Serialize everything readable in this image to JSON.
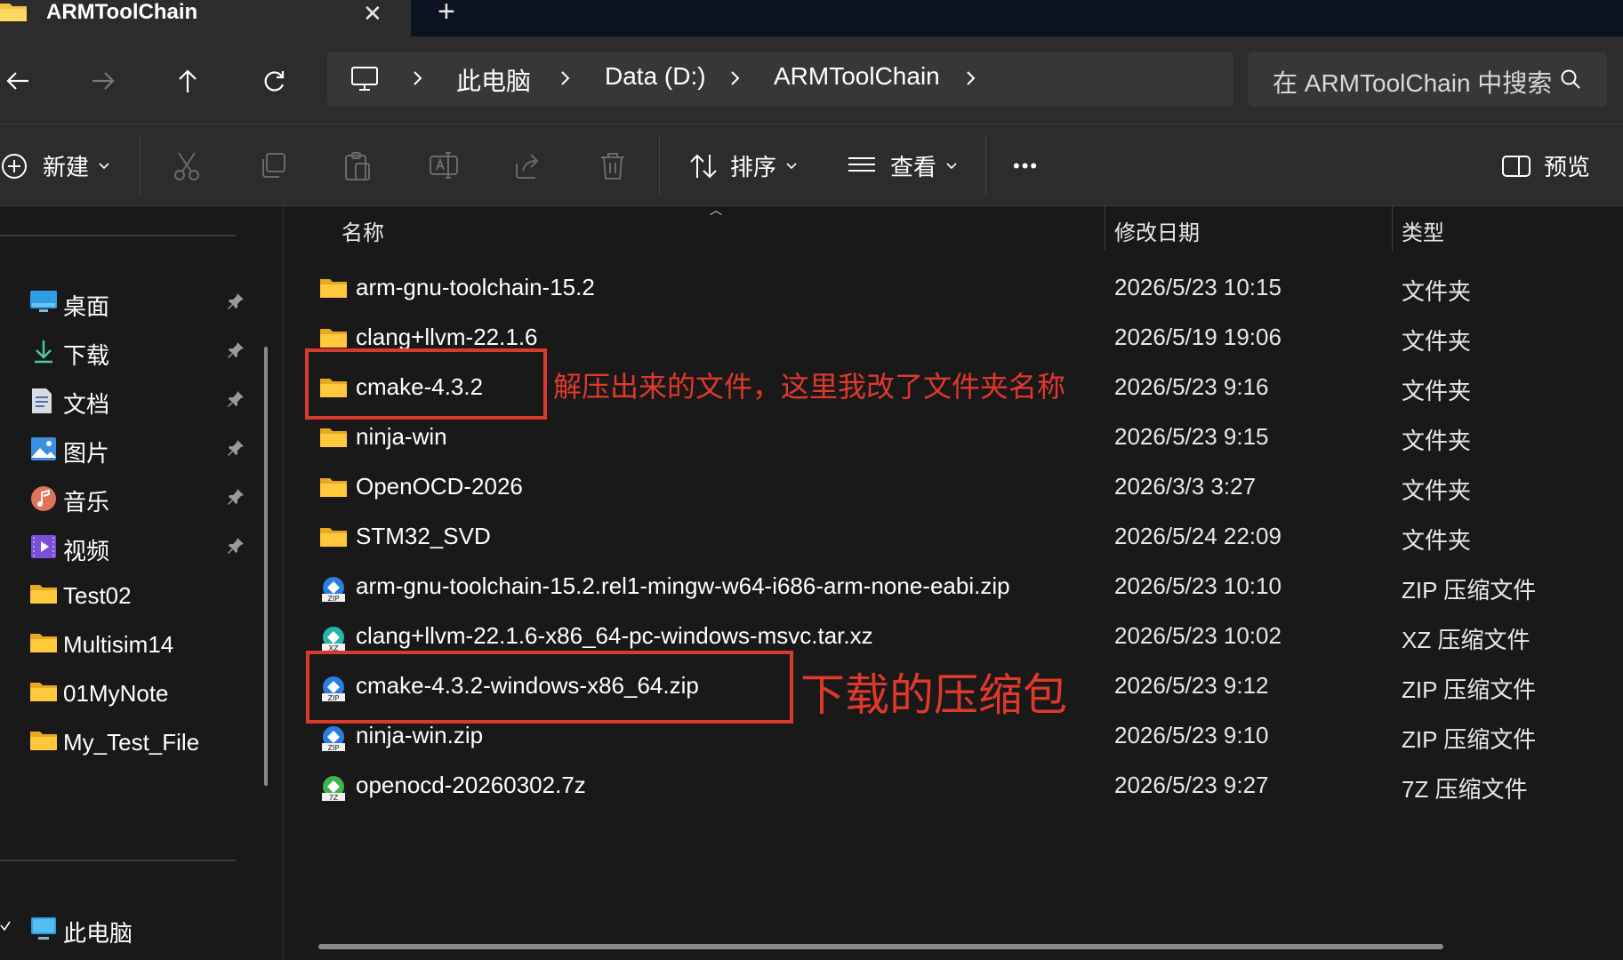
{
  "window": {
    "tab_title": "ARMToolChain",
    "close_glyph": "✕",
    "newtab_glyph": "+"
  },
  "nav": {
    "breadcrumbs": [
      "此电脑",
      "Data (D:)",
      "ARMToolChain"
    ],
    "search_placeholder": "在 ARMToolChain 中搜索"
  },
  "toolbar": {
    "new_label": "新建",
    "sort_label": "排序",
    "view_label": "查看",
    "more_label": "•••",
    "preview_label": "预览"
  },
  "sidebar": {
    "quick_access": [
      {
        "label": "桌面",
        "icon": "desktop-icon",
        "pinned": true
      },
      {
        "label": "下载",
        "icon": "download-icon",
        "pinned": true
      },
      {
        "label": "文档",
        "icon": "document-icon",
        "pinned": true
      },
      {
        "label": "图片",
        "icon": "pictures-icon",
        "pinned": true
      },
      {
        "label": "音乐",
        "icon": "music-icon",
        "pinned": true
      },
      {
        "label": "视频",
        "icon": "videos-icon",
        "pinned": true
      },
      {
        "label": "Test02",
        "icon": "folder-icon",
        "pinned": false
      },
      {
        "label": "Multisim14",
        "icon": "folder-icon",
        "pinned": false
      },
      {
        "label": "01MyNote",
        "icon": "folder-icon",
        "pinned": false
      },
      {
        "label": "My_Test_File",
        "icon": "folder-icon",
        "pinned": false
      }
    ],
    "this_pc_label": "此电脑"
  },
  "columns": {
    "name": "名称",
    "date": "修改日期",
    "type": "类型"
  },
  "files": [
    {
      "name": "arm-gnu-toolchain-15.2",
      "date": "2026/5/23 10:15",
      "type": "文件夹",
      "icon": "folder-icon"
    },
    {
      "name": "clang+llvm-22.1.6",
      "date": "2026/5/19 19:06",
      "type": "文件夹",
      "icon": "folder-icon"
    },
    {
      "name": "cmake-4.3.2",
      "date": "2026/5/23 9:16",
      "type": "文件夹",
      "icon": "folder-icon"
    },
    {
      "name": "ninja-win",
      "date": "2026/5/23 9:15",
      "type": "文件夹",
      "icon": "folder-icon"
    },
    {
      "name": "OpenOCD-2026",
      "date": "2026/3/3 3:27",
      "type": "文件夹",
      "icon": "folder-icon"
    },
    {
      "name": "STM32_SVD",
      "date": "2026/5/24 22:09",
      "type": "文件夹",
      "icon": "folder-icon"
    },
    {
      "name": "arm-gnu-toolchain-15.2.rel1-mingw-w64-i686-arm-none-eabi.zip",
      "date": "2026/5/23 10:10",
      "type": "ZIP 压缩文件",
      "icon": "zip-archive-icon"
    },
    {
      "name": "clang+llvm-22.1.6-x86_64-pc-windows-msvc.tar.xz",
      "date": "2026/5/23 10:02",
      "type": "XZ 压缩文件",
      "icon": "xz-archive-icon"
    },
    {
      "name": "cmake-4.3.2-windows-x86_64.zip",
      "date": "2026/5/23 9:12",
      "type": "ZIP 压缩文件",
      "icon": "zip-archive-icon"
    },
    {
      "name": "ninja-win.zip",
      "date": "2026/5/23 9:10",
      "type": "ZIP 压缩文件",
      "icon": "zip-archive-icon"
    },
    {
      "name": "openocd-20260302.7z",
      "date": "2026/5/23 9:27",
      "type": "7Z 压缩文件",
      "icon": "7z-archive-icon"
    }
  ],
  "annotations": {
    "extracted_note": "解压出来的文件，这里我改了文件夹名称",
    "download_note": "下载的压缩包",
    "color": "#e0392b"
  },
  "colors": {
    "accent": "#60cdff",
    "folder": "#f5c242",
    "annotation_red": "#d83a2e"
  }
}
